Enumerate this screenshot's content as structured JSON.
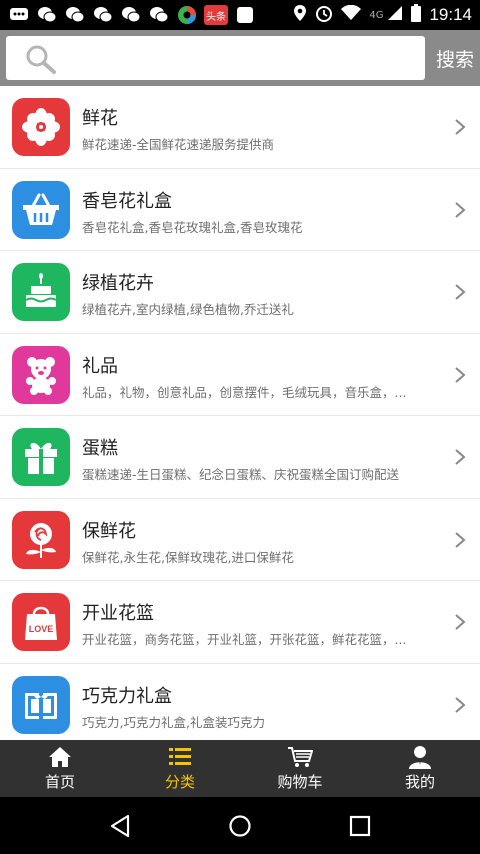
{
  "status_bar": {
    "app_badge": "头条",
    "network": "4G",
    "time": "19:14"
  },
  "header": {
    "search_placeholder": "",
    "search_button": "搜索"
  },
  "categories": [
    {
      "title": "鲜花",
      "subtitle": "鲜花速递-全国鲜花速递服务提供商",
      "icon": "flower-icon",
      "color": "#e5383b"
    },
    {
      "title": "香皂花礼盒",
      "subtitle": "香皂花礼盒,香皂花玫瑰礼盒,香皂玫瑰花",
      "icon": "basket-icon",
      "color": "#2d8fe2"
    },
    {
      "title": "绿植花卉",
      "subtitle": "绿植花卉,室内绿植,绿色植物,乔迁送礼",
      "icon": "cake-plant-icon",
      "color": "#1fb660"
    },
    {
      "title": "礼品",
      "subtitle": "礼品，礼物，创意礼品，创意摆件，毛绒玩具，音乐盒，...",
      "icon": "teddy-bear-icon",
      "color": "#e0399b"
    },
    {
      "title": "蛋糕",
      "subtitle": "蛋糕速递-生日蛋糕、纪念日蛋糕、庆祝蛋糕全国订购配送",
      "icon": "gift-icon",
      "color": "#1fb660"
    },
    {
      "title": "保鲜花",
      "subtitle": "保鲜花,永生花,保鲜玫瑰花,进口保鲜花",
      "icon": "rose-icon",
      "color": "#e5383b"
    },
    {
      "title": "开业花篮",
      "subtitle": " 开业花篮，商务花篮，开业礼篮，开张花篮，鲜花花篮，...",
      "icon": "love-bag-icon",
      "color": "#e5383b"
    },
    {
      "title": "巧克力礼盒",
      "subtitle": "巧克力,巧克力礼盒,礼盒装巧克力",
      "icon": "chocolate-box-icon",
      "color": "#2d8fe2"
    }
  ],
  "tabs": [
    {
      "label": "首页",
      "icon": "home-icon",
      "active": false
    },
    {
      "label": "分类",
      "icon": "list-icon",
      "active": true
    },
    {
      "label": "购物车",
      "icon": "cart-icon",
      "active": false
    },
    {
      "label": "我的",
      "icon": "user-icon",
      "active": false
    }
  ],
  "colors": {
    "accent": "#f5c400",
    "header_bg": "#8a8a8a",
    "tabbar_bg": "#313131"
  }
}
